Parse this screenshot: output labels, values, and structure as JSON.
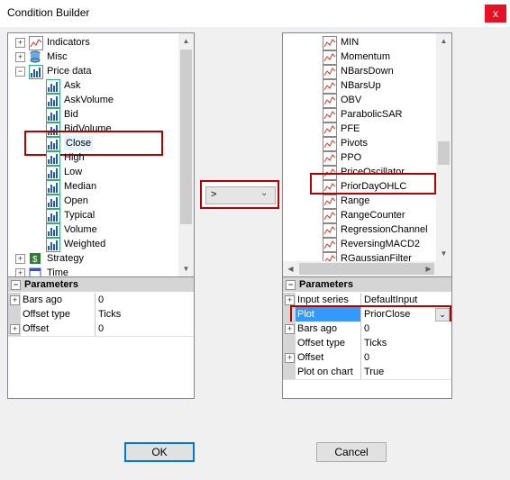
{
  "window": {
    "title": "Condition Builder",
    "close_glyph": "x"
  },
  "left_tree": {
    "items": [
      {
        "label": "Indicators",
        "expander": "+",
        "icon": "line-chart-icon"
      },
      {
        "label": "Misc",
        "expander": "+",
        "icon": "database-icon"
      },
      {
        "label": "Price data",
        "expander": "−",
        "icon": "bar-chart-icon"
      },
      {
        "label": "Ask",
        "icon": "bar-chart-icon"
      },
      {
        "label": "AskVolume",
        "icon": "bar-chart-icon"
      },
      {
        "label": "Bid",
        "icon": "bar-chart-icon"
      },
      {
        "label": "BidVolume",
        "icon": "bar-chart-icon"
      },
      {
        "label": "Close",
        "icon": "bar-chart-icon",
        "selected": true
      },
      {
        "label": "High",
        "icon": "bar-chart-icon"
      },
      {
        "label": "Low",
        "icon": "bar-chart-icon"
      },
      {
        "label": "Median",
        "icon": "bar-chart-icon"
      },
      {
        "label": "Open",
        "icon": "bar-chart-icon"
      },
      {
        "label": "Typical",
        "icon": "bar-chart-icon"
      },
      {
        "label": "Volume",
        "icon": "bar-chart-icon"
      },
      {
        "label": "Weighted",
        "icon": "bar-chart-icon"
      },
      {
        "label": "Strategy",
        "expander": "+",
        "icon": "dollar-icon"
      },
      {
        "label": "Time",
        "expander": "+",
        "icon": "calendar-icon"
      }
    ]
  },
  "left_params": {
    "header": "Parameters",
    "rows": [
      {
        "name": "Bars ago",
        "value": "0",
        "expander": "+"
      },
      {
        "name": "Offset type",
        "value": "Ticks",
        "expander": ""
      },
      {
        "name": "Offset",
        "value": "0",
        "expander": "+"
      }
    ]
  },
  "operator": {
    "value": ">"
  },
  "right_list": {
    "items": [
      {
        "label": "MIN"
      },
      {
        "label": "Momentum"
      },
      {
        "label": "NBarsDown"
      },
      {
        "label": "NBarsUp"
      },
      {
        "label": "OBV"
      },
      {
        "label": "ParabolicSAR"
      },
      {
        "label": "PFE"
      },
      {
        "label": "Pivots"
      },
      {
        "label": "PPO"
      },
      {
        "label": "PriceOscillator"
      },
      {
        "label": "PriorDayOHLC",
        "selected": true
      },
      {
        "label": "Range"
      },
      {
        "label": "RangeCounter"
      },
      {
        "label": "RegressionChannel"
      },
      {
        "label": "ReversingMACD2"
      },
      {
        "label": "RGaussianFilter"
      }
    ]
  },
  "right_params": {
    "header": "Parameters",
    "rows": [
      {
        "name": "Input series",
        "value": "DefaultInput",
        "expander": "+"
      },
      {
        "name": "Plot",
        "value": "PriorClose",
        "expander": "",
        "dropdown": true
      },
      {
        "name": "Bars ago",
        "value": "0",
        "expander": "+"
      },
      {
        "name": "Offset type",
        "value": "Ticks",
        "expander": ""
      },
      {
        "name": "Offset",
        "value": "0",
        "expander": "+"
      },
      {
        "name": "Plot on chart",
        "value": "True",
        "expander": ""
      }
    ]
  },
  "buttons": {
    "ok": "OK",
    "cancel": "Cancel"
  },
  "colors": {
    "highlight": "#b30000",
    "accent": "#0078d7",
    "selected_row": "#3399ff"
  }
}
